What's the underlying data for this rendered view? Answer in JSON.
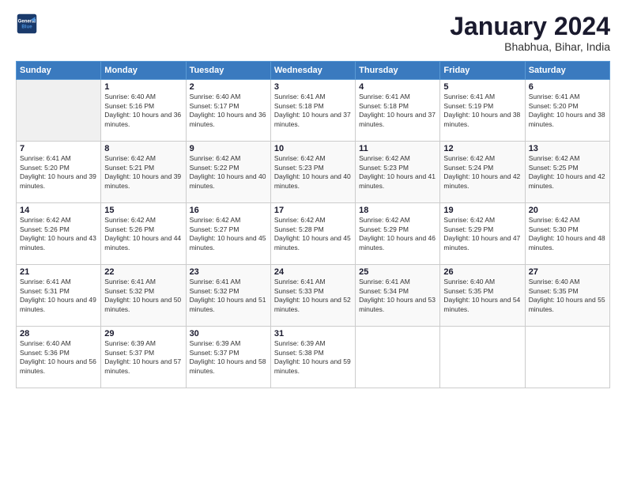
{
  "header": {
    "logo_line1": "General",
    "logo_line2": "Blue",
    "month": "January 2024",
    "location": "Bhabhua, Bihar, India"
  },
  "weekdays": [
    "Sunday",
    "Monday",
    "Tuesday",
    "Wednesday",
    "Thursday",
    "Friday",
    "Saturday"
  ],
  "weeks": [
    [
      {
        "day": "",
        "sunrise": "",
        "sunset": "",
        "daylight": ""
      },
      {
        "day": "1",
        "sunrise": "Sunrise: 6:40 AM",
        "sunset": "Sunset: 5:16 PM",
        "daylight": "Daylight: 10 hours and 36 minutes."
      },
      {
        "day": "2",
        "sunrise": "Sunrise: 6:40 AM",
        "sunset": "Sunset: 5:17 PM",
        "daylight": "Daylight: 10 hours and 36 minutes."
      },
      {
        "day": "3",
        "sunrise": "Sunrise: 6:41 AM",
        "sunset": "Sunset: 5:18 PM",
        "daylight": "Daylight: 10 hours and 37 minutes."
      },
      {
        "day": "4",
        "sunrise": "Sunrise: 6:41 AM",
        "sunset": "Sunset: 5:18 PM",
        "daylight": "Daylight: 10 hours and 37 minutes."
      },
      {
        "day": "5",
        "sunrise": "Sunrise: 6:41 AM",
        "sunset": "Sunset: 5:19 PM",
        "daylight": "Daylight: 10 hours and 38 minutes."
      },
      {
        "day": "6",
        "sunrise": "Sunrise: 6:41 AM",
        "sunset": "Sunset: 5:20 PM",
        "daylight": "Daylight: 10 hours and 38 minutes."
      }
    ],
    [
      {
        "day": "7",
        "sunrise": "Sunrise: 6:41 AM",
        "sunset": "Sunset: 5:20 PM",
        "daylight": "Daylight: 10 hours and 39 minutes."
      },
      {
        "day": "8",
        "sunrise": "Sunrise: 6:42 AM",
        "sunset": "Sunset: 5:21 PM",
        "daylight": "Daylight: 10 hours and 39 minutes."
      },
      {
        "day": "9",
        "sunrise": "Sunrise: 6:42 AM",
        "sunset": "Sunset: 5:22 PM",
        "daylight": "Daylight: 10 hours and 40 minutes."
      },
      {
        "day": "10",
        "sunrise": "Sunrise: 6:42 AM",
        "sunset": "Sunset: 5:23 PM",
        "daylight": "Daylight: 10 hours and 40 minutes."
      },
      {
        "day": "11",
        "sunrise": "Sunrise: 6:42 AM",
        "sunset": "Sunset: 5:23 PM",
        "daylight": "Daylight: 10 hours and 41 minutes."
      },
      {
        "day": "12",
        "sunrise": "Sunrise: 6:42 AM",
        "sunset": "Sunset: 5:24 PM",
        "daylight": "Daylight: 10 hours and 42 minutes."
      },
      {
        "day": "13",
        "sunrise": "Sunrise: 6:42 AM",
        "sunset": "Sunset: 5:25 PM",
        "daylight": "Daylight: 10 hours and 42 minutes."
      }
    ],
    [
      {
        "day": "14",
        "sunrise": "Sunrise: 6:42 AM",
        "sunset": "Sunset: 5:26 PM",
        "daylight": "Daylight: 10 hours and 43 minutes."
      },
      {
        "day": "15",
        "sunrise": "Sunrise: 6:42 AM",
        "sunset": "Sunset: 5:26 PM",
        "daylight": "Daylight: 10 hours and 44 minutes."
      },
      {
        "day": "16",
        "sunrise": "Sunrise: 6:42 AM",
        "sunset": "Sunset: 5:27 PM",
        "daylight": "Daylight: 10 hours and 45 minutes."
      },
      {
        "day": "17",
        "sunrise": "Sunrise: 6:42 AM",
        "sunset": "Sunset: 5:28 PM",
        "daylight": "Daylight: 10 hours and 45 minutes."
      },
      {
        "day": "18",
        "sunrise": "Sunrise: 6:42 AM",
        "sunset": "Sunset: 5:29 PM",
        "daylight": "Daylight: 10 hours and 46 minutes."
      },
      {
        "day": "19",
        "sunrise": "Sunrise: 6:42 AM",
        "sunset": "Sunset: 5:29 PM",
        "daylight": "Daylight: 10 hours and 47 minutes."
      },
      {
        "day": "20",
        "sunrise": "Sunrise: 6:42 AM",
        "sunset": "Sunset: 5:30 PM",
        "daylight": "Daylight: 10 hours and 48 minutes."
      }
    ],
    [
      {
        "day": "21",
        "sunrise": "Sunrise: 6:41 AM",
        "sunset": "Sunset: 5:31 PM",
        "daylight": "Daylight: 10 hours and 49 minutes."
      },
      {
        "day": "22",
        "sunrise": "Sunrise: 6:41 AM",
        "sunset": "Sunset: 5:32 PM",
        "daylight": "Daylight: 10 hours and 50 minutes."
      },
      {
        "day": "23",
        "sunrise": "Sunrise: 6:41 AM",
        "sunset": "Sunset: 5:32 PM",
        "daylight": "Daylight: 10 hours and 51 minutes."
      },
      {
        "day": "24",
        "sunrise": "Sunrise: 6:41 AM",
        "sunset": "Sunset: 5:33 PM",
        "daylight": "Daylight: 10 hours and 52 minutes."
      },
      {
        "day": "25",
        "sunrise": "Sunrise: 6:41 AM",
        "sunset": "Sunset: 5:34 PM",
        "daylight": "Daylight: 10 hours and 53 minutes."
      },
      {
        "day": "26",
        "sunrise": "Sunrise: 6:40 AM",
        "sunset": "Sunset: 5:35 PM",
        "daylight": "Daylight: 10 hours and 54 minutes."
      },
      {
        "day": "27",
        "sunrise": "Sunrise: 6:40 AM",
        "sunset": "Sunset: 5:35 PM",
        "daylight": "Daylight: 10 hours and 55 minutes."
      }
    ],
    [
      {
        "day": "28",
        "sunrise": "Sunrise: 6:40 AM",
        "sunset": "Sunset: 5:36 PM",
        "daylight": "Daylight: 10 hours and 56 minutes."
      },
      {
        "day": "29",
        "sunrise": "Sunrise: 6:39 AM",
        "sunset": "Sunset: 5:37 PM",
        "daylight": "Daylight: 10 hours and 57 minutes."
      },
      {
        "day": "30",
        "sunrise": "Sunrise: 6:39 AM",
        "sunset": "Sunset: 5:37 PM",
        "daylight": "Daylight: 10 hours and 58 minutes."
      },
      {
        "day": "31",
        "sunrise": "Sunrise: 6:39 AM",
        "sunset": "Sunset: 5:38 PM",
        "daylight": "Daylight: 10 hours and 59 minutes."
      },
      {
        "day": "",
        "sunrise": "",
        "sunset": "",
        "daylight": ""
      },
      {
        "day": "",
        "sunrise": "",
        "sunset": "",
        "daylight": ""
      },
      {
        "day": "",
        "sunrise": "",
        "sunset": "",
        "daylight": ""
      }
    ]
  ]
}
